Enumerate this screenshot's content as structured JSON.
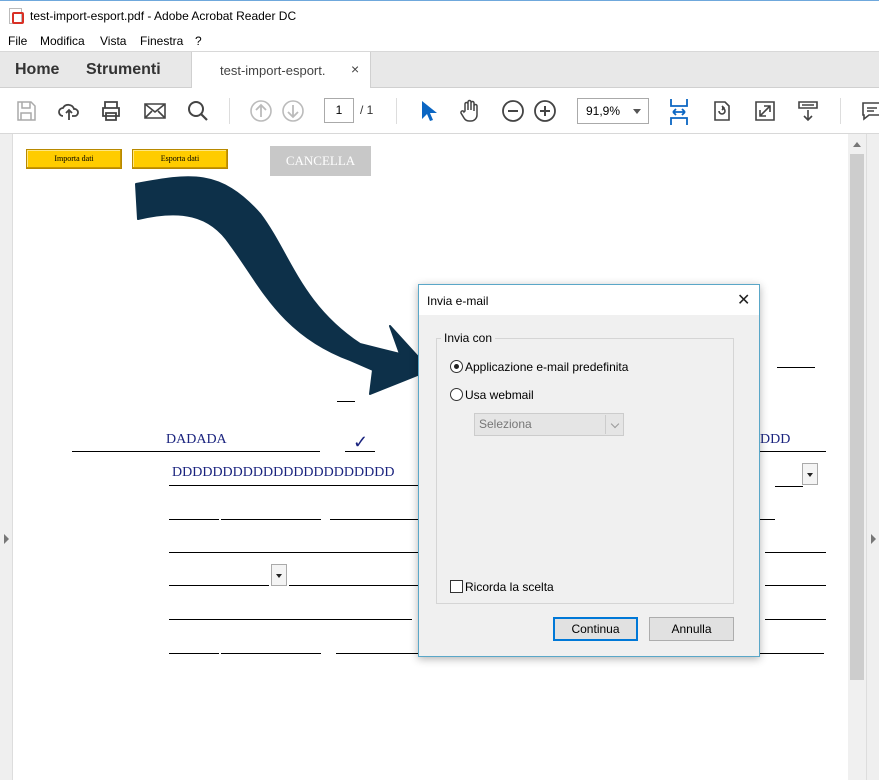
{
  "window": {
    "title": "test-import-esport.pdf - Adobe Acrobat Reader DC"
  },
  "menu": {
    "items": [
      "File",
      "Modifica",
      "Vista",
      "Finestra",
      "?"
    ]
  },
  "tabs": {
    "home": "Home",
    "tools": "Strumenti",
    "doc": "test-import-esport.",
    "close": "×"
  },
  "toolbar": {
    "page_current": "1",
    "page_total": "/ 1",
    "zoom": "91,9%",
    "icons": [
      "save-icon",
      "cloud-upload-icon",
      "print-icon",
      "mail-icon",
      "search-icon",
      "page-up-icon",
      "page-down-icon",
      "select-cursor-icon",
      "hand-icon",
      "zoom-out-icon",
      "zoom-in-icon",
      "fit-page-icon",
      "rotate-icon",
      "fullscreen-icon",
      "scroll-mode-icon",
      "comment-icon"
    ]
  },
  "form": {
    "import_label": "Importa dati",
    "export_label": "Esporta dati",
    "cancel_label": "CANCELLA",
    "field_dadada": "DADADA",
    "field_dddd": "DDDDDDDDDDDDDDDDDDDDDD",
    "field_ddd_right": "DDD",
    "checkmark": "✓"
  },
  "dialog": {
    "title": "Invia e-mail",
    "close": "✕",
    "group_label": "Invia con",
    "option_default": "Applicazione e-mail predefinita",
    "option_default_selected": true,
    "option_webmail": "Usa webmail",
    "webmail_select": "Seleziona",
    "remember": "Ricorda la scelta",
    "ok": "Continua",
    "cancel": "Annulla"
  },
  "colors": {
    "accent": "#0078d7",
    "form_button": "#ffcc00",
    "arrow": "#0d3049",
    "field_text": "#1a237e"
  }
}
